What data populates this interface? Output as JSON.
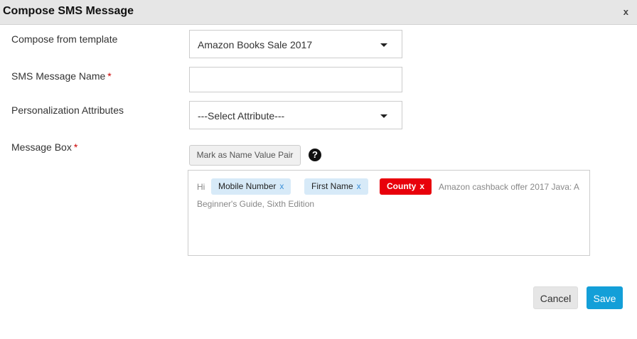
{
  "dialog": {
    "title": "Compose SMS Message",
    "close_label": "x"
  },
  "form": {
    "template": {
      "label": "Compose from template",
      "selected": "Amazon Books Sale 2017"
    },
    "message_name": {
      "label": "SMS Message Name",
      "required_mark": "*",
      "value": "",
      "placeholder": ""
    },
    "personalization": {
      "label": "Personalization Attributes",
      "selected": "---Select Attribute---"
    },
    "message_box": {
      "label": "Message Box",
      "required_mark": "*",
      "mark_button_label": "Mark as Name Value Pair",
      "help_icon_glyph": "?",
      "prefix_text": "Hi",
      "tags": [
        {
          "label": "Mobile Number",
          "remove": "x"
        },
        {
          "label": "First Name",
          "remove": "x"
        },
        {
          "label": "County",
          "remove": "x",
          "highlight": "#e8000b"
        }
      ],
      "body_line1": "Amazon cashback offer 2017 Java: A",
      "body_line2": "Beginner's Guide, Sixth Edition"
    }
  },
  "footer": {
    "cancel_label": "Cancel",
    "save_label": "Save"
  },
  "colors": {
    "header_bg": "#e6e6e6",
    "accent": "#139fd8",
    "tag_bg": "#d7eaf8",
    "tag_error": "#e8000b",
    "required": "#cc0000"
  }
}
